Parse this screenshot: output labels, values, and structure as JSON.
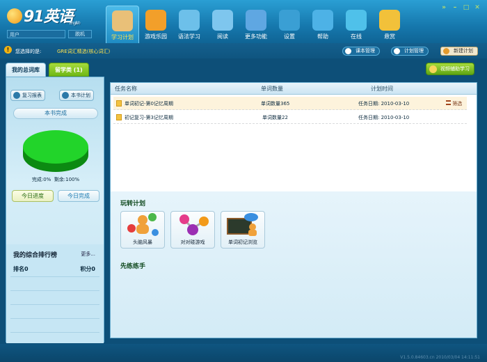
{
  "app": {
    "logo_text": "91英语",
    "logo_sub": "English",
    "user_placeholder": "用户",
    "offline_label": "脱机"
  },
  "nav": [
    {
      "label": "学习计划",
      "icon": "calendar-icon",
      "color": "#e9c078",
      "active": true
    },
    {
      "label": "游戏乐园",
      "icon": "gamepad-icon",
      "color": "#f29f2a"
    },
    {
      "label": "语法学习",
      "icon": "monitor-icon",
      "color": "#6dc0ea"
    },
    {
      "label": "阅读",
      "icon": "book-icon",
      "color": "#7ec6ee"
    },
    {
      "label": "更多功能",
      "icon": "box-icon",
      "color": "#5fa7e2"
    },
    {
      "label": "设置",
      "icon": "gear-icon",
      "color": "#3a9fd4"
    },
    {
      "label": "帮助",
      "icon": "help-icon",
      "color": "#4db2e6"
    },
    {
      "label": "在线",
      "icon": "globe-icon",
      "color": "#4fc1ea"
    },
    {
      "label": "悬赏",
      "icon": "coins-icon",
      "color": "#f2c13a"
    }
  ],
  "window_buttons": [
    "»",
    "–",
    "□",
    "✕"
  ],
  "infobar": {
    "warn": "!",
    "selected_label": "您选择的是:",
    "selected_value": "GRE词汇精选(核心词汇)",
    "course_mgmt": "课本管理",
    "plan_mgmt": "计划管理",
    "new_plan": "新建计划"
  },
  "tabs": {
    "my_vocab": "我的总词库",
    "study_abroad": "留学类 (1)"
  },
  "video_help": "视频辅助学习",
  "left": {
    "review_report": "复习报表",
    "book_plan": "本书计划",
    "book_done": "本书完成",
    "progress_done_label": "完成:0%",
    "progress_left_label": "剩余:100%",
    "done_fraction": 0,
    "today_progress": "今日进度",
    "today_done": "今日完成",
    "rank_title": "我的综合排行榜",
    "rank_more": "更多...",
    "rank_label": "排名0",
    "score_label": "积分0"
  },
  "table": {
    "headers": [
      "任务名称",
      "单词数量",
      "计划时间"
    ],
    "rows": [
      {
        "name": "单词初记-第0记忆周期",
        "count": "单词数量365",
        "date": "任务日期: 2010-03-10",
        "action": "筛选"
      },
      {
        "name": "初记复习-第3记忆周期",
        "count": "单词数量22",
        "date": "任务日期: 2010-03-10",
        "action": ""
      }
    ]
  },
  "fun_plan": {
    "title": "玩转计划",
    "cards": [
      {
        "label": "头脑风暴",
        "icon": "brainstorm-icon"
      },
      {
        "label": "对对碰游戏",
        "icon": "molecule-icon"
      },
      {
        "label": "单词初记浏览",
        "icon": "word-board-icon"
      }
    ]
  },
  "practice_title": "先练练手",
  "version": "V1.5.0.84603.cn 2010/03/04 14:11:51"
}
